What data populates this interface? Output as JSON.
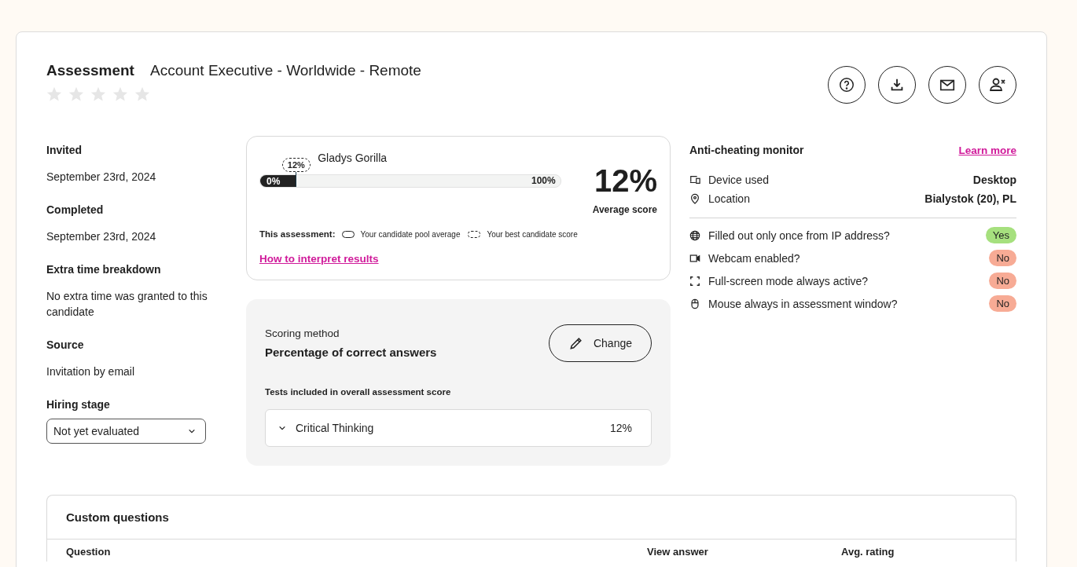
{
  "header": {
    "title": "Assessment",
    "subtitle": "Account Executive - Worldwide - Remote",
    "stars": 0,
    "actions": [
      {
        "kind": "help"
      },
      {
        "kind": "download"
      },
      {
        "kind": "email"
      },
      {
        "kind": "remove-user"
      }
    ]
  },
  "details": [
    {
      "label": "Invited",
      "value": "September 23rd, 2024"
    },
    {
      "label": "Completed",
      "value": "September 23rd, 2024"
    },
    {
      "label": "Extra time breakdown",
      "value": "No extra time was granted to this candidate"
    },
    {
      "label": "Source",
      "value": "Invitation by email"
    }
  ],
  "hiring_stage": {
    "label": "Hiring stage",
    "value": "Not yet evaluated"
  },
  "score_card": {
    "candidate": "Gladys Gorilla",
    "marker": "12%",
    "level": 0.12,
    "min": "0%",
    "max": "100%",
    "score": "12%",
    "score_label": "Average score",
    "legend_title": "This assessment:",
    "legend": [
      {
        "kind": "solid",
        "label": "Your candidate pool average"
      },
      {
        "kind": "dashed",
        "label": "Your best candidate score"
      }
    ],
    "link": "How to interpret results"
  },
  "scoring": {
    "label": "Scoring method",
    "method": "Percentage of correct answers",
    "button": "Change",
    "tests_title": "Tests included in overall assessment score",
    "tests": [
      {
        "name": "Critical Thinking",
        "score": "12%"
      }
    ]
  },
  "anti_cheating": {
    "title": "Anti-cheating monitor",
    "link": "Learn more",
    "info": [
      {
        "kind": "device",
        "label": "Device used",
        "value": "Desktop"
      },
      {
        "kind": "location",
        "label": "Location",
        "value": "Bialystok (20), PL"
      }
    ],
    "checks": [
      {
        "kind": "ip",
        "label": "Filled out only once from IP address?",
        "answer": "Yes",
        "passed": true
      },
      {
        "kind": "webcam",
        "label": "Webcam enabled?",
        "answer": "No",
        "passed": false
      },
      {
        "kind": "fullscreen",
        "label": "Full-screen mode always active?",
        "answer": "No",
        "passed": false
      },
      {
        "kind": "mouse",
        "label": "Mouse always in assessment window?",
        "answer": "No",
        "passed": false
      }
    ]
  },
  "custom_questions": {
    "title": "Custom questions",
    "columns": [
      "Question",
      "View answer",
      "Avg. rating"
    ]
  }
}
